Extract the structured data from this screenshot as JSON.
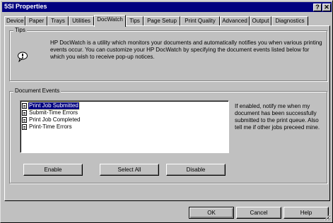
{
  "window": {
    "title": "5SI Properties",
    "help_glyph": "?",
    "close_glyph": "✕"
  },
  "tabs": [
    {
      "label": "Device",
      "active": false
    },
    {
      "label": "Paper",
      "active": false
    },
    {
      "label": "Trays",
      "active": false
    },
    {
      "label": "Utilities",
      "active": false
    },
    {
      "label": "DocWatch",
      "active": true
    },
    {
      "label": "Tips",
      "active": false
    },
    {
      "label": "Page Setup",
      "active": false
    },
    {
      "label": "Print Quality",
      "active": false
    },
    {
      "label": "Advanced",
      "active": false
    },
    {
      "label": "Output",
      "active": false
    },
    {
      "label": "Diagnostics",
      "active": false
    }
  ],
  "tips": {
    "group_title": "Tips",
    "icon": "speech-bubble-icon",
    "text": "HP DocWatch is a utility which monitors your documents and automatically notifies you when various printing events occur.   You can customize your HP DocWatch by specifying the document events listed below for which you wish to receive pop-up notices."
  },
  "events": {
    "group_title": "Document Events",
    "items": [
      {
        "label": "Print Job Submitted",
        "selected": true
      },
      {
        "label": "Submit-Time Errors",
        "selected": false
      },
      {
        "label": "Print Job Completed",
        "selected": false
      },
      {
        "label": "Print-Time Errors",
        "selected": false
      }
    ],
    "note": "If enabled, notify me when my document has been successfully submitted to the print queue.  Also tell me if other jobs preceed mine.",
    "enable_label": "Enable",
    "select_all_label": "Select All",
    "disable_label": "Disable"
  },
  "footer": {
    "ok_label": "OK",
    "cancel_label": "Cancel",
    "help_label": "Help"
  },
  "colors": {
    "titlebar": "#000080",
    "face": "#c0c0c0",
    "selection": "#000080"
  }
}
